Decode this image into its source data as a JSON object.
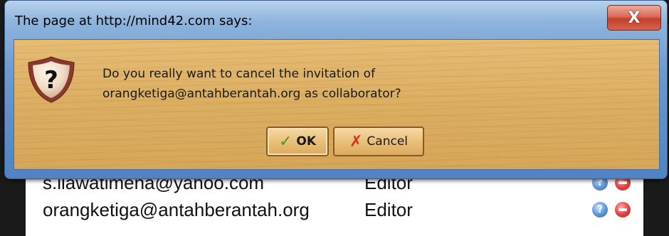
{
  "dialog": {
    "title": "The page at http://mind42.com says:",
    "close_label": "X",
    "message_line1": "Do you really want to cancel the invitation of",
    "message_line2": "orangketiga@antahberantah.org as collaborator?",
    "ok_label": "OK",
    "cancel_label": "Cancel",
    "icon": "question-shield-icon"
  },
  "background_list": {
    "rows": [
      {
        "email": "s.ilawatimena@yahoo.com",
        "role": "Editor"
      },
      {
        "email": "orangketiga@antahberantah.org",
        "role": "Editor"
      }
    ],
    "info_icon": "help-circle-icon",
    "remove_icon": "remove-circle-icon"
  },
  "colors": {
    "title_bar": "#6c9ad0",
    "wood": "#dcae62",
    "close_button": "#c0412c",
    "check": "#3aa02a",
    "cross": "#d8321e"
  }
}
